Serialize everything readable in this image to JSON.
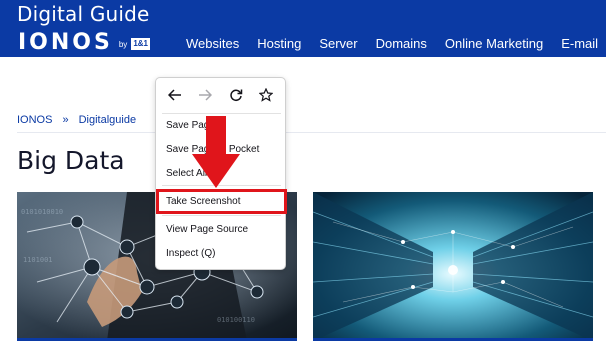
{
  "header": {
    "site_title": "Digital Guide",
    "logo_text": "IONOS",
    "logo_by": "by",
    "logo_brand": "1&1",
    "nav": [
      "Websites",
      "Hosting",
      "Server",
      "Domains",
      "Online Marketing",
      "E-mail"
    ]
  },
  "breadcrumb": {
    "items": [
      "IONOS",
      "»",
      "Digitalguide"
    ]
  },
  "page": {
    "title": "Big Data"
  },
  "context_menu": {
    "items": [
      {
        "label": "Save Page"
      },
      {
        "label": "Save Page to Pocket"
      },
      {
        "label": "Select All"
      },
      {
        "label": "Take Screenshot"
      },
      {
        "label": "View Page Source"
      },
      {
        "label": "Inspect (Q)"
      }
    ],
    "nav_icons": [
      "back-arrow-icon",
      "forward-arrow-icon",
      "reload-icon",
      "bookmark-star-icon"
    ]
  },
  "colors": {
    "header_bg": "#0b3aa4",
    "highlight": "#e0151b",
    "arrow": "#e0151b"
  }
}
